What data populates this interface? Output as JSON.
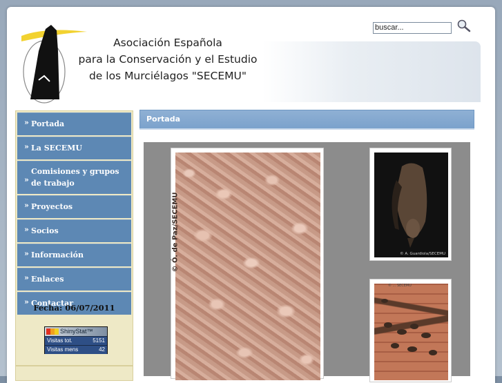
{
  "header": {
    "org_line1": "Asociación Española",
    "org_line2": "para la Conservación y el Estudio",
    "org_line3": "de los Murciélagos \"SECEMU\""
  },
  "search": {
    "placeholder": "buscar...",
    "value": "buscar..."
  },
  "sidebar": {
    "marker": "»",
    "items": [
      {
        "label": "Portada"
      },
      {
        "label": "La SECEMU"
      },
      {
        "label": "Comisiones y grupos de trabajo"
      },
      {
        "label": "Proyectos"
      },
      {
        "label": "Socios"
      },
      {
        "label": "Información"
      },
      {
        "label": "Enlaces"
      },
      {
        "label": "Contactar"
      }
    ],
    "date": "Fecha: 06/07/2011"
  },
  "shinystat": {
    "brand": "ShinyStat™",
    "rows": [
      {
        "label": "Visitas tot.",
        "value": "5151"
      },
      {
        "label": "Visitas mens",
        "value": "42"
      }
    ]
  },
  "main": {
    "section_title": "Portada",
    "photos": [
      {
        "watermark": "© Ó. de Paz/SECEMU"
      },
      {
        "credit": "© A. Guardiola/SECEMU"
      },
      {
        "credit": "© ... SECEMU"
      }
    ]
  },
  "colors": {
    "nav_blue": "#5d88b4",
    "sidebar_cream": "#eee9c6",
    "header_bar": "#7ba2cc",
    "gallery_gray": "#8c8c8c"
  }
}
